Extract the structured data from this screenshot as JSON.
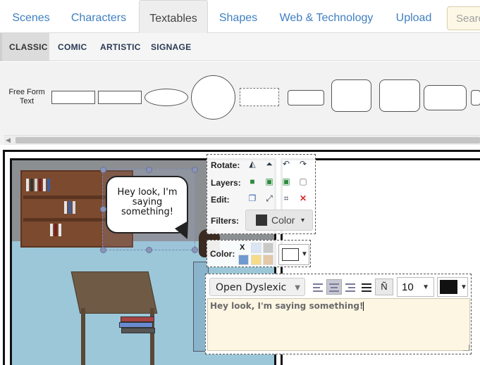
{
  "nav": {
    "tabs": [
      {
        "label": "Scenes"
      },
      {
        "label": "Characters"
      },
      {
        "label": "Textables"
      },
      {
        "label": "Shapes"
      },
      {
        "label": "Web & Technology"
      },
      {
        "label": "Upload"
      }
    ],
    "active_tab": "Textables",
    "search_placeholder": "Search"
  },
  "subtabs": [
    {
      "label": "CLASSIC"
    },
    {
      "label": "COMIC"
    },
    {
      "label": "ARTISTIC"
    },
    {
      "label": "SIGNAGE"
    }
  ],
  "library": {
    "free_form_label": "Free Form Text"
  },
  "bubble": {
    "text": "Hey look, I'm saying something!"
  },
  "toolbox": {
    "rotate_label": "Rotate:",
    "layers_label": "Layers:",
    "edit_label": "Edit:",
    "filters_label": "Filters:",
    "filters_button_label": "Color",
    "color_label": "Color:",
    "clear_color_label": "X",
    "swatches": [
      "#d9e5f3",
      "#c8c8c8",
      "#6f9ad0",
      "#f5dc8a",
      "#e3c9a8"
    ]
  },
  "text_editor": {
    "font": "Open Dyslexic",
    "size": "10",
    "special_chars_label": "Ñ",
    "text_color": "#111111",
    "content": "Hey look, I'm saying something!"
  }
}
